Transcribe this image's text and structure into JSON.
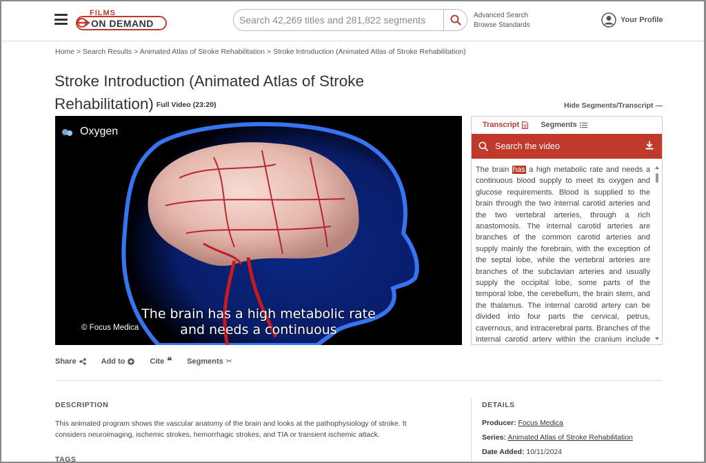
{
  "header": {
    "logo_top": "FILMS",
    "logo_main": "ON DEMAND",
    "search_placeholder": "Search 42,269 titles and 281,822 segments",
    "advanced_search": "Advanced Search",
    "browse_standards": "Browse Standards",
    "profile_label": "Your Profile"
  },
  "breadcrumb": [
    "Home",
    "Search Results",
    "Animated Atlas of Stroke Rehabilitation",
    "Stroke Introduction (Animated Atlas of Stroke Rehabilitation)"
  ],
  "breadcrumb_sep": " > ",
  "title": {
    "text": "Stroke Introduction (Animated Atlas of Stroke Rehabilitation)",
    "full_video": "Full Video (23:20)"
  },
  "hide_segments": "Hide Segments/Transcript —",
  "video": {
    "overlay_label": "Oxygen",
    "caption_line1": "The brain has a high metabolic rate",
    "caption_line2": "and needs a continuous",
    "copyright": "© Focus Medica"
  },
  "actions": [
    {
      "label": "Share",
      "icon": "share-icon"
    },
    {
      "label": "Add to",
      "icon": "plus-circle-icon"
    },
    {
      "label": "Cite",
      "icon": "quote-icon"
    },
    {
      "label": "Segments",
      "icon": "scissors-icon"
    }
  ],
  "panel": {
    "tab_transcript": "Transcript",
    "tab_segments": "Segments",
    "search_label": "Search the video",
    "transcript_before": "The brain ",
    "transcript_highlight": "has",
    "transcript_after": " a high metabolic rate and needs a continuous blood supply to meet its oxygen and glucose requirements. Blood is supplied to the brain through the two internal carotid arteries and the two vertebral arteries, through a rich anastomosis. The internal carotid arteries are branches of the common carotid arteries and supply mainly the forebrain, with the exception of the septal lobe, while the vertebral arteries are branches of the subclavian arteries and usually supply the occipital lobe, some parts of the temporal lobe, the cerebellum, the brain stem, and the thalamus. The internal carotid artery can be divided into four parts the cervical, petrus, cavernous, and intracerebral parts. Branches of the internal carotid artery within the cranium include the ophthalmic artery, the posterior communicating artery,"
  },
  "description": {
    "heading": "DESCRIPTION",
    "text": "This animated program shows the vascular anatomy of the brain and looks at the pathophysiology of stroke. It considers neuroimaging, ischemic strokes, hemorrhagic strokes, and TIA or transient ischemic attack."
  },
  "tags_heading": "TAGS",
  "details": {
    "heading": "DETAILS",
    "producer_label": "Producer:",
    "producer": "Focus Medica",
    "series_label": "Series:",
    "series": "Animated Atlas of Stroke Rehabilitation",
    "date_label": "Date Added:",
    "date": "10/11/2024"
  },
  "colors": {
    "accent": "#c0392b",
    "text": "#333333"
  }
}
